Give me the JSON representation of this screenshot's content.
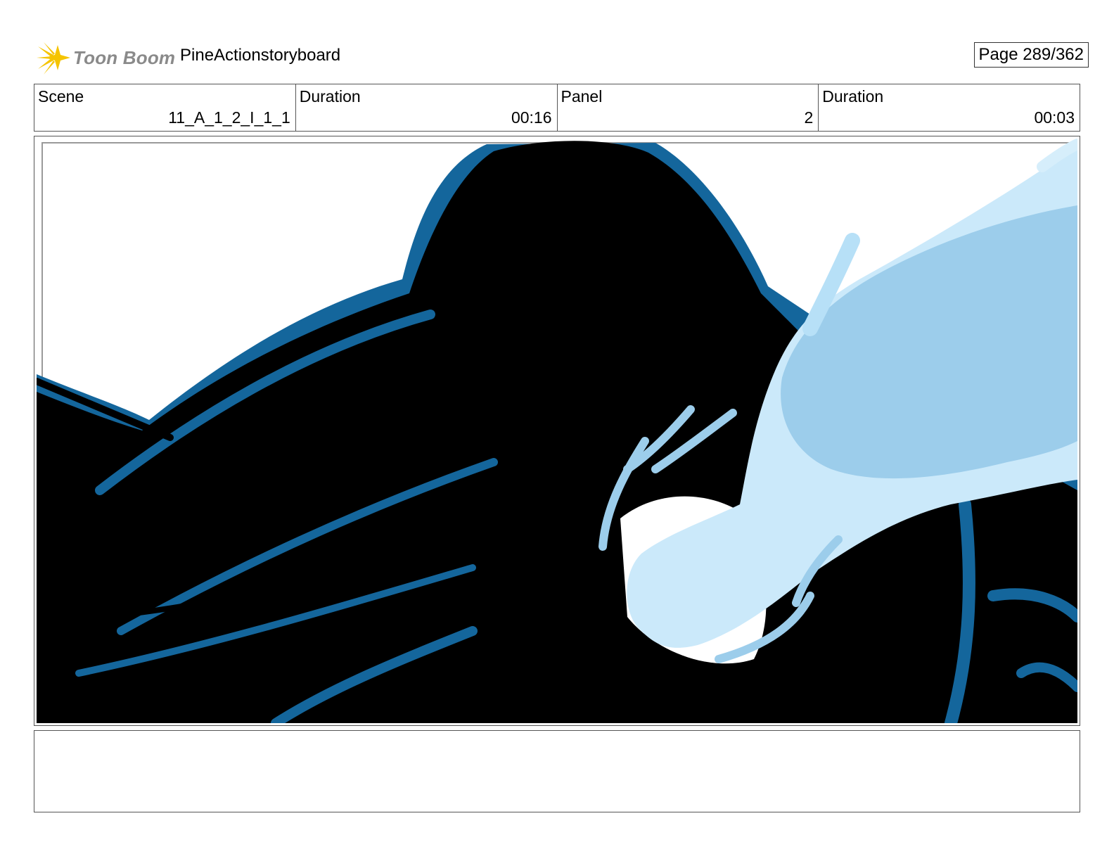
{
  "header": {
    "logo_text": "Toon Boom",
    "project_title": "PineActionstoryboard",
    "page_label": "Page 289/362"
  },
  "info": {
    "scene_label": "Scene",
    "scene_value": "11_A_1_2_I_1_1",
    "scene_duration_label": "Duration",
    "scene_duration_value": "00:16",
    "panel_label": "Panel",
    "panel_value": "2",
    "panel_duration_label": "Duration",
    "panel_duration_value": "00:03"
  },
  "panel_image": {
    "colors": {
      "black": "#000000",
      "dark_blue": "#14669c",
      "light_blue": "#cbe9fa",
      "mid_blue": "#9ccdeb",
      "white": "#ffffff"
    }
  },
  "logo_colors": {
    "star": "#f5c400",
    "text": "#8a8a8a"
  }
}
